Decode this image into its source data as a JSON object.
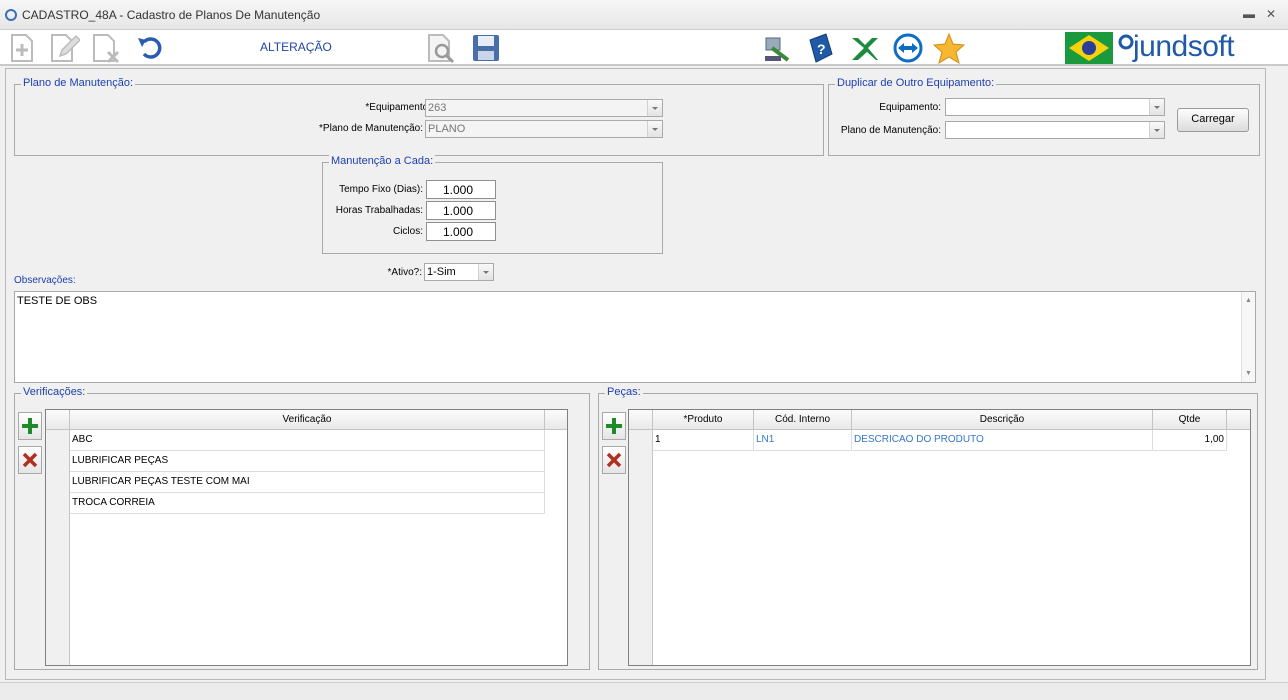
{
  "window": {
    "title": "CADASTRO_48A - Cadastro de Planos De Manutenção"
  },
  "toolbar": {
    "mode_label": "ALTERAÇÃO",
    "icons": [
      "add-icon",
      "edit-icon",
      "delete-icon",
      "undo-icon",
      "preview-icon",
      "save-icon",
      "tools-icon",
      "help-book-icon",
      "excel-icon",
      "teamviewer-icon",
      "favorite-star-icon",
      "brazil-flag-icon"
    ],
    "brand": "jundsoft"
  },
  "plano": {
    "legend": "Plano de Manutenção:",
    "equipamento_label": "*Equipamento:",
    "equipamento_value": "263",
    "plano_label": "*Plano de Manutenção:",
    "plano_value": "PLANO"
  },
  "duplicar": {
    "legend": "Duplicar de Outro Equipamento:",
    "equipamento_label": "Equipamento:",
    "equipamento_value": "",
    "plano_label": "Plano de Manutenção:",
    "plano_value": "",
    "carregar_label": "Carregar"
  },
  "manutencao": {
    "legend": "Manutenção a Cada:",
    "tempo_label": "Tempo Fixo (Dias):",
    "tempo_value": "1.000",
    "horas_label": "Horas Trabalhadas:",
    "horas_value": "1.000",
    "ciclos_label": "Ciclos:",
    "ciclos_value": "1.000"
  },
  "ativo": {
    "label": "*Ativo?:",
    "value": "1-Sim"
  },
  "observacoes": {
    "label": "Observações:",
    "value": "TESTE DE OBS"
  },
  "verificacoes": {
    "legend": "Verificações:",
    "header": "Verificação",
    "rows": [
      "ABC",
      "LUBRIFICAR PEÇAS",
      "LUBRIFICAR PEÇAS TESTE COM MAI",
      "TROCA CORREIA"
    ]
  },
  "pecas": {
    "legend": "Peças:",
    "headers": [
      "*Produto",
      "Cód. Interno",
      "Descrição",
      "Qtde"
    ],
    "rows": [
      {
        "produto": "1",
        "cod": "LN1",
        "descricao": "DESCRICAO DO PRODUTO",
        "qtde": "1,00"
      }
    ]
  },
  "colors": {
    "accent": "#1c3fb0",
    "link_text": "#3377cc"
  }
}
